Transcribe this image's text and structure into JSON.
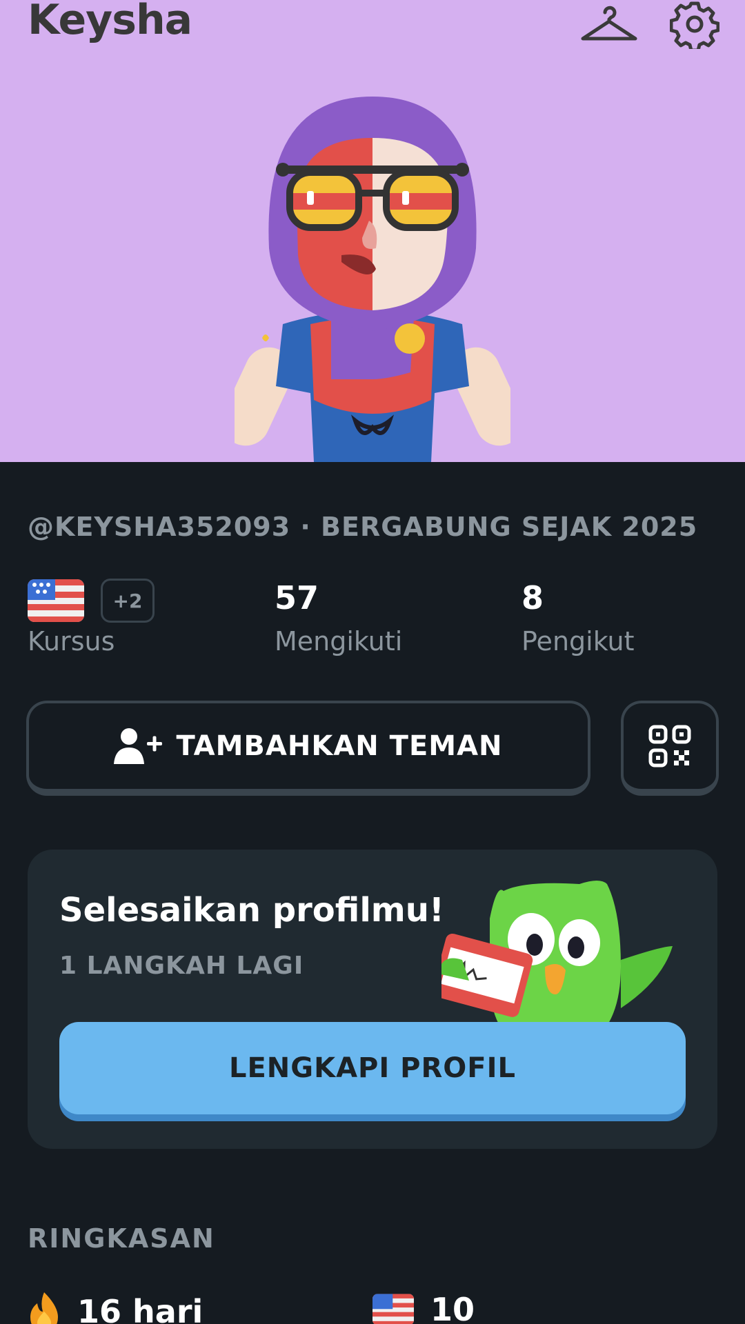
{
  "header": {
    "title": "Keysha",
    "wardrobe_icon": "hanger-icon",
    "settings_icon": "gear-icon",
    "background_color": "#d5b0f0"
  },
  "profile": {
    "meta": "@KEYSHA352093 · BERGABUNG SEJAK 2025",
    "courses": {
      "label": "Kursus",
      "flag_icon": "us-flag-icon",
      "extra": "+2"
    },
    "following": {
      "value": "57",
      "label": "Mengikuti"
    },
    "followers": {
      "value": "8",
      "label": "Pengikut"
    }
  },
  "actions": {
    "add_friend_label": "TAMBAHKAN TEMAN",
    "add_friend_icon": "add-person-icon",
    "qr_icon": "qr-code-icon"
  },
  "completion_card": {
    "title": "Selesaikan profilmu!",
    "subtitle": "1 LANGKAH LAGI",
    "button_label": "LENGKAPI PROFIL",
    "button_color": "#6bb8ef"
  },
  "summary": {
    "title": "RINGKASAN",
    "streak": {
      "icon": "flame-icon",
      "value": "16 hari"
    },
    "course_xp": {
      "icon": "us-flag-icon",
      "value": "10"
    }
  }
}
